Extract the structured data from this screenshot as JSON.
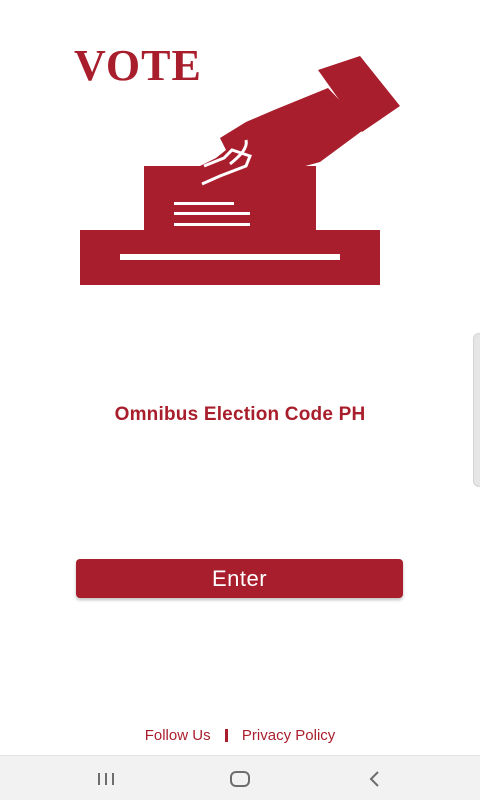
{
  "logo": {
    "word": "VOTE",
    "icon": "ballot-box-hand-icon"
  },
  "app": {
    "title": "Omnibus Election Code PH"
  },
  "enter_button": {
    "label": "Enter"
  },
  "footer": {
    "follow_us": "Follow Us",
    "privacy_policy": "Privacy Policy"
  },
  "nav_bar": {
    "recent_icon": "recent-apps-icon",
    "home_icon": "home-icon",
    "back_icon": "back-icon"
  },
  "colors": {
    "brand": "#A91E2C",
    "nav_icon": "#6d6d6d",
    "background": "#ffffff"
  }
}
